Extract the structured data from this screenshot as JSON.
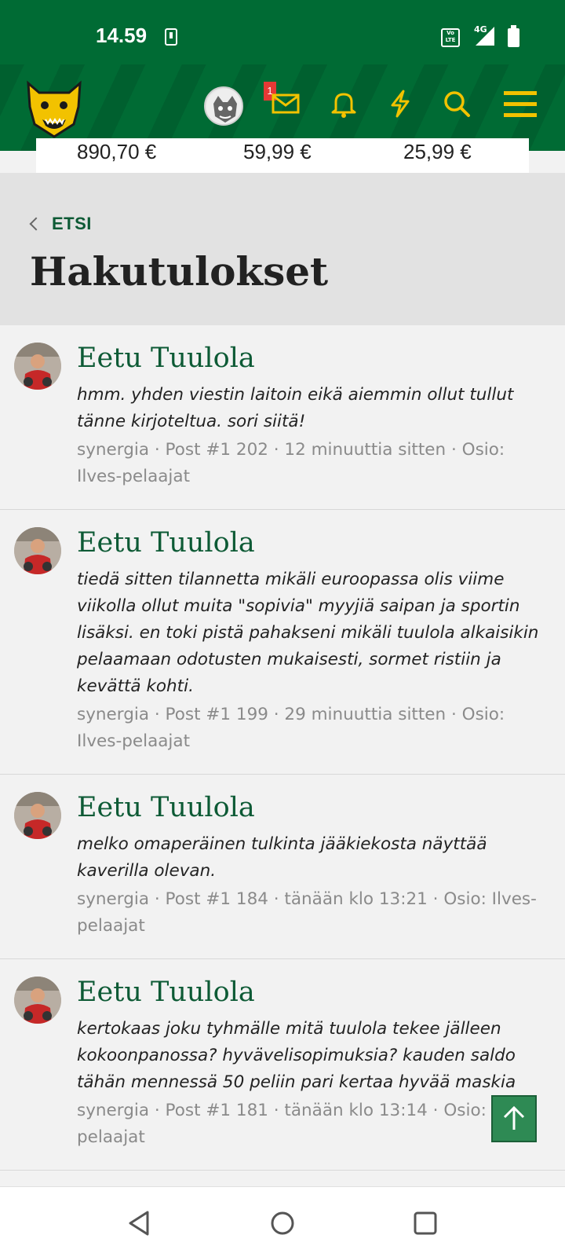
{
  "status_bar": {
    "time": "14.59",
    "network": "4G",
    "volte": "Vo LTE"
  },
  "header": {
    "notification_count": "1",
    "icons": [
      "logo",
      "user-avatar",
      "mail-icon",
      "bell-icon",
      "bolt-icon",
      "search-icon",
      "menu-icon"
    ],
    "brand_color": "#006b34",
    "icon_color": "#f2c200"
  },
  "ad_strip": {
    "prices": [
      "890,70 €",
      "59,99 €",
      "25,99 €"
    ]
  },
  "page": {
    "back_label": "ETSI",
    "title": "Hakutulokset"
  },
  "results": [
    {
      "title": "Eetu Tuulola",
      "snippet": "hmm. yhden viestin laitoin eikä aiemmin ollut tullut tänne kirjoteltua. sori siitä!",
      "meta": "synergia · Post #1 202 · 12 minuuttia sitten · Osio: Ilves-pelaajat"
    },
    {
      "title": "Eetu Tuulola",
      "snippet": "tiedä sitten tilannetta mikäli euroopassa olis viime viikolla ollut muita \"sopivia\" myyjiä saipan ja sportin lisäksi. en toki pistä pahakseni mikäli tuulola alkaisikin pelaamaan odotusten mukaisesti, sormet ristiin ja kevättä kohti.",
      "meta": "synergia · Post #1 199 · 29 minuuttia sitten · Osio: Ilves-pelaajat"
    },
    {
      "title": "Eetu Tuulola",
      "snippet": "melko omaperäinen tulkinta jääkiekosta näyttää kaverilla olevan.",
      "meta": "synergia · Post #1 184 · tänään klo 13:21 · Osio: Ilves-pelaajat"
    },
    {
      "title": "Eetu Tuulola",
      "snippet": "kertokaas joku tyhmälle mitä tuulola tekee jälleen kokoonpanossa? hyvävelisopimuksia? kauden saldo tähän mennessä 50 peliin pari kertaa hyvää maskia",
      "meta": "synergia · Post #1 181 · tänään klo 13:14 · Osio: Ilves-pelaajat"
    }
  ]
}
